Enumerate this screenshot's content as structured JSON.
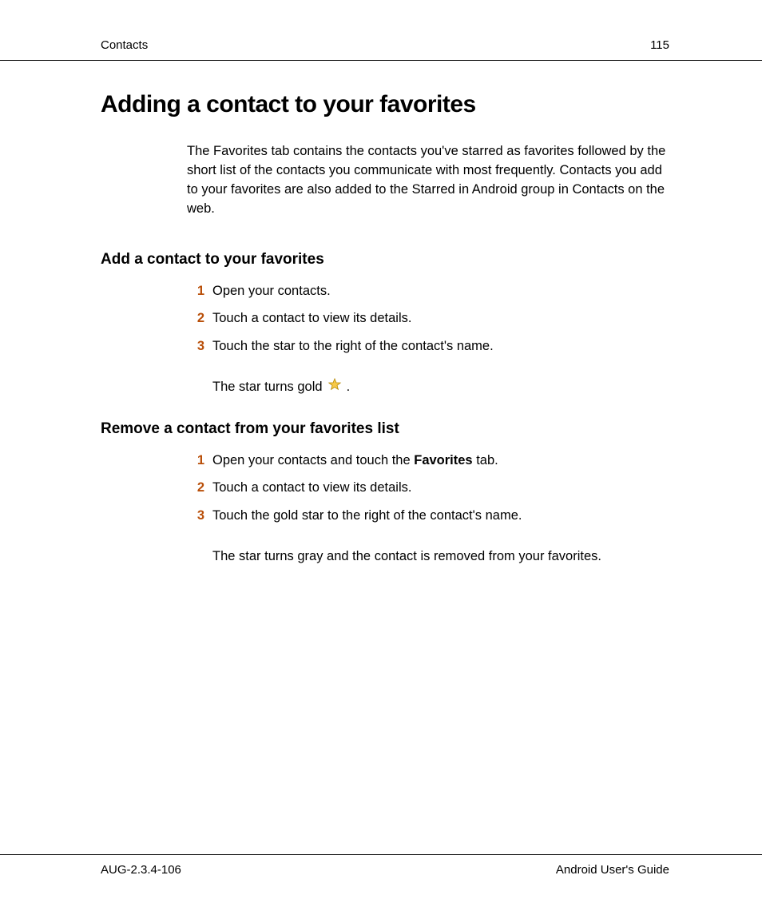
{
  "header": {
    "section": "Contacts",
    "pageNumber": "115"
  },
  "main": {
    "heading": "Adding a contact to your favorites",
    "intro": "The Favorites tab contains the contacts you've starred as favorites followed by the short list of the contacts you communicate with most frequently. Contacts you add to your favorites are also added to the Starred in Android group in Contacts on the web.",
    "section1": {
      "heading": "Add a contact to your favorites",
      "steps": {
        "s1": {
          "num": "1",
          "text": "Open your contacts."
        },
        "s2": {
          "num": "2",
          "text": "Touch a contact to view its details."
        },
        "s3": {
          "num": "3",
          "text": "Touch the star to the right of the contact's name."
        }
      },
      "subline_prefix": "The star turns gold ",
      "subline_suffix": " ."
    },
    "section2": {
      "heading": "Remove a contact from your favorites list",
      "steps": {
        "s1": {
          "num": "1",
          "text_prefix": "Open your contacts and touch the ",
          "text_bold": "Favorites",
          "text_suffix": " tab."
        },
        "s2": {
          "num": "2",
          "text": "Touch a contact to view its details."
        },
        "s3": {
          "num": "3",
          "text": "Touch the gold star to the right of the contact's name."
        }
      },
      "subline": "The star turns gray and the contact is removed from your favorites."
    }
  },
  "footer": {
    "left": "AUG-2.3.4-106",
    "right": "Android User's Guide"
  },
  "colors": {
    "stepNumber": "#b94f09",
    "starFill": "#f7c948",
    "starStroke": "#b38600"
  }
}
